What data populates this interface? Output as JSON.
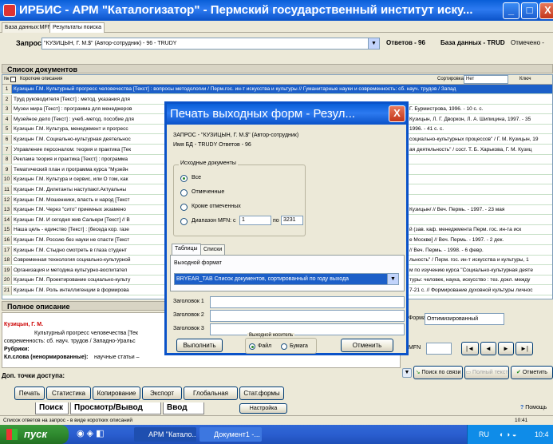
{
  "window": {
    "title": "ИРБИС - АРМ \"Каталогизатор\" - Пермский государственный институт иску...",
    "min": "_",
    "max": "□",
    "close": "X"
  },
  "top_tabs": [
    "База данных:MFN",
    "Результаты поиска"
  ],
  "query": {
    "label": "Запрос",
    "value": "\"КУЗИЦЫН, Г. М.$\" (Автор-сотрудник) - 96 - TRUDY",
    "answers_label": "Ответов - 96",
    "db_label": "База данных - TRUD",
    "marked_label": "Отмечено -"
  },
  "documents": {
    "heading": "Список документов",
    "col_num": "№",
    "col_desc": "Короткие описания",
    "sort_label": "Сортировка",
    "sort_value": "Нет",
    "key_label": "Ключ",
    "rows": [
      "Кузицын Г.М. Культурный прогресс человечества [Текст] : вопросы методологии / Перм.гос. ин-т искусства и культуры // Гуманитарные науки и современность: сб. науч. трудов / Запад",
      "Труд руководителя [Текст] : метод. указания для",
      "Музеи мира [Текст] : программа для менеджеров",
      "Музейное дело [Текст] : учеб.-метод. пособие для",
      "Кузицын Г.М. Культура, менеджмент и прогресс",
      "Кузицын Г.М. Социально-культурная деятельнос",
      "Управление персоналом: теория и практика [Тек",
      "Реклама теория и практика [Текст] : программа",
      "Тематический план и программа курса \"Музейн",
      "Кузицын Г.М. Культура и сервис, или О том, как",
      "Кузицын Г.М. Дилетанты наступают.Актуальны",
      "Кузицын Г.М. Мошенники, власть и народ [Текст",
      "Кузицын Г.М. Через \"сито\" приемных экзамено",
      "Кузицын Г.М. И сегодня жив Сальери [Текст] // В",
      "Наша цель - единство [Текст] : [беседа кор. газе",
      "Кузицын Г.М. Россию без науки не спасти [Текст",
      "Кузицын Г.М. Стыдно смотреть в глаза студент",
      "Современная технология социально-культурной",
      "Организация и методика культурно-воспитател",
      "Кузицын Г.М. Проектирование социально-культу",
      "Кузицын Г.М. Роль интеллигенции в формирова"
    ],
    "right_fragments": [
      "Г. Бурмистрова, 1996. - 10 с. с.",
      "Кузицын, Л. Г. Дворкон, Л. А. Шипицина, 1997. - 35",
      "1996. - 41 с. с.",
      "социально-культурных процессов\" / Г. М. Кузицын, 19",
      "ая деятельность\" / сост. Т. Б. Харькова, Г. М. Кузиц",
      "Кузицын/ // Веч. Пермь. - 1997. - 23 мая",
      "й (зав. каф. менеджмента Перм. гос. ин-та иск",
      "е Москве] // Веч. Пермь. - 1997. - 2 дек.",
      "// Веч. Пермь. - 1998. - 6 февр.",
      "льность\" / Перм. гос. ин-т искусства и культуры, 1",
      "м по изучению курса \"Социально-культурная деяте",
      "туры: человек, наука, искусство : тез. докл. между",
      "7-21 с. // Формирование духовной культуры личнос"
    ]
  },
  "full": {
    "heading": "Полное описание",
    "author": "Кузицын, Г. М.",
    "line1": "Культурный прогресс человечества [Тек",
    "line2": "современность: сб. науч. трудов / Западно-Уральс",
    "rubrics": "Рубрики:",
    "keywords_label": "Кл.слова (ненормированные):",
    "keywords": "научные статьи –",
    "access": "Доп. точки доступа:",
    "format_label": "Формат",
    "format_value": "Оптимизированный",
    "mfn_label": "MFN"
  },
  "actions": {
    "search_by_links": "Поиск по связи",
    "full_text": "Полный текст",
    "mark": "Отметить"
  },
  "toolbar": [
    "Печать",
    "Статистика",
    "Копирование",
    "Экспорт",
    "Глобальная",
    "Стат.формы"
  ],
  "bottom_tabs": [
    "Поиск",
    "Просмотр/Вывод",
    "Ввод"
  ],
  "settings_label": "Настройка",
  "help_label": "Помощь",
  "status": {
    "text": "Список ответов на запрос - в виде коротких описаний",
    "time": "10:41"
  },
  "dialog": {
    "title": "Печать выходных форм - Резул...",
    "close": "X",
    "query_line": "ЗАПРОС - \"КУЗИЦЫН, Г. М.$\" (Автор-сотрудник)",
    "db_line": "Имя БД - TRUDY  Ответов - 96",
    "source_group": "Исходные документы",
    "opt_all": "Все",
    "opt_marked": "Отмеченные",
    "opt_except": "Кроме отмеченных",
    "opt_range": "Диапазон MFN:  с",
    "range_from": "1",
    "range_to_label": "по",
    "range_to": "3231",
    "tab_tables": "Таблицы",
    "tab_lists": "Списки",
    "output_format_label": "Выходной формат",
    "output_format_value": "BRYEAR_TAB Список документов, сортированный по году выхода",
    "header1": "Заголовок 1",
    "header2": "Заголовок 2",
    "header3": "Заголовок 3",
    "run_button": "Выполнить",
    "carrier_group": "Выходной носитель",
    "carrier_file": "Файл",
    "carrier_paper": "Бумага",
    "cancel_button": "Отменить"
  },
  "taskbar": {
    "start": "пуск",
    "tasks": [
      "АРМ \"Катало...",
      "Документ1 -..."
    ],
    "lang": "RU",
    "clock": "10:4"
  }
}
